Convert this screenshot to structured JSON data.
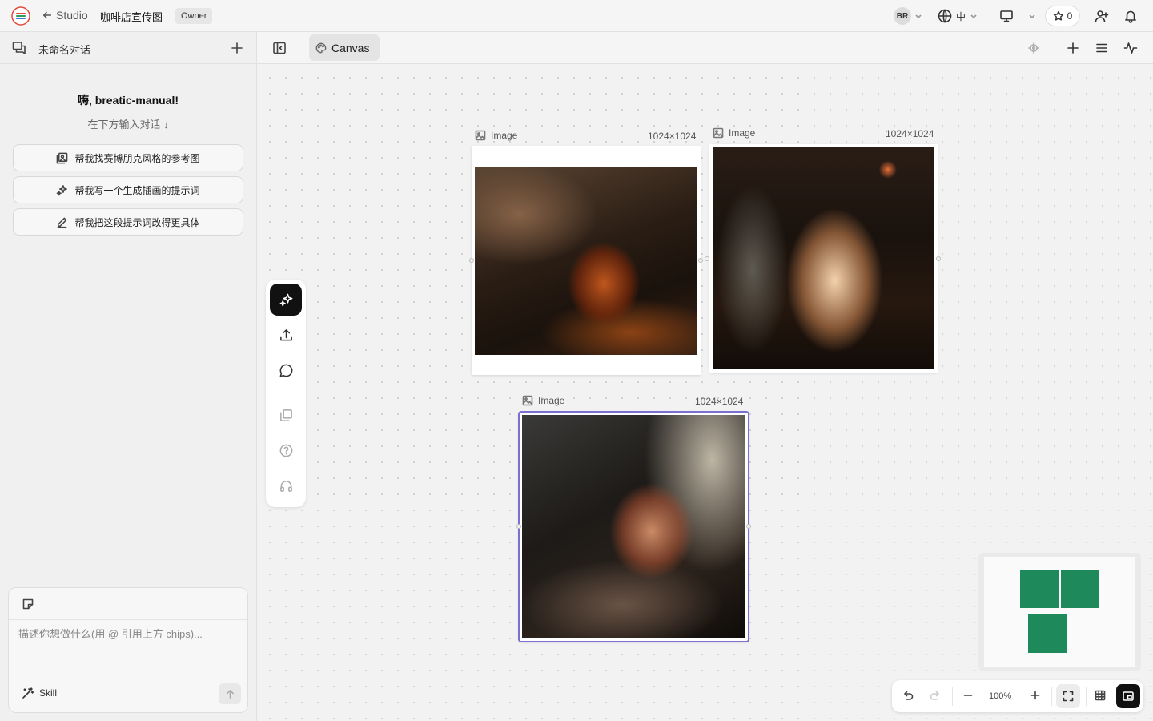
{
  "topbar": {
    "back_label": "Studio",
    "project_title": "咖啡店宣传图",
    "role": "Owner",
    "avatar_initials": "BR",
    "language": "中",
    "stars": "0"
  },
  "sidebar": {
    "conversation_title": "未命名对话",
    "greeting": "嗨, breatic-manual!",
    "hint": "在下方输入对话 ↓",
    "suggestions": [
      {
        "label": "帮我找赛博朋克风格的参考图",
        "icon": "image-search-icon"
      },
      {
        "label": "帮我写一个生成插画的提示词",
        "icon": "sparkle-icon"
      },
      {
        "label": "帮我把这段提示词改得更具体",
        "icon": "pencil-icon"
      }
    ],
    "composer": {
      "placeholder": "描述你想做什么(用 @ 引用上方 chips)...",
      "value": "",
      "skill_label": "Skill"
    }
  },
  "canvas_header": {
    "tab_label": "Canvas"
  },
  "canvas": {
    "nodes": [
      {
        "label": "Image",
        "size": "1024×1024",
        "subject": "pour-over coffee with steam"
      },
      {
        "label": "Image",
        "size": "1024×1024",
        "subject": "cafe interior with window light"
      },
      {
        "label": "Image",
        "size": "1024×1024",
        "subject": "coffee cup with beans on wooden table",
        "selected": true
      }
    ]
  },
  "zoom_bar": {
    "zoom_level": "100%"
  },
  "colors": {
    "accent_green": "#1e8a5c",
    "selection": "#7b6fd0",
    "dark_button": "#111111"
  }
}
